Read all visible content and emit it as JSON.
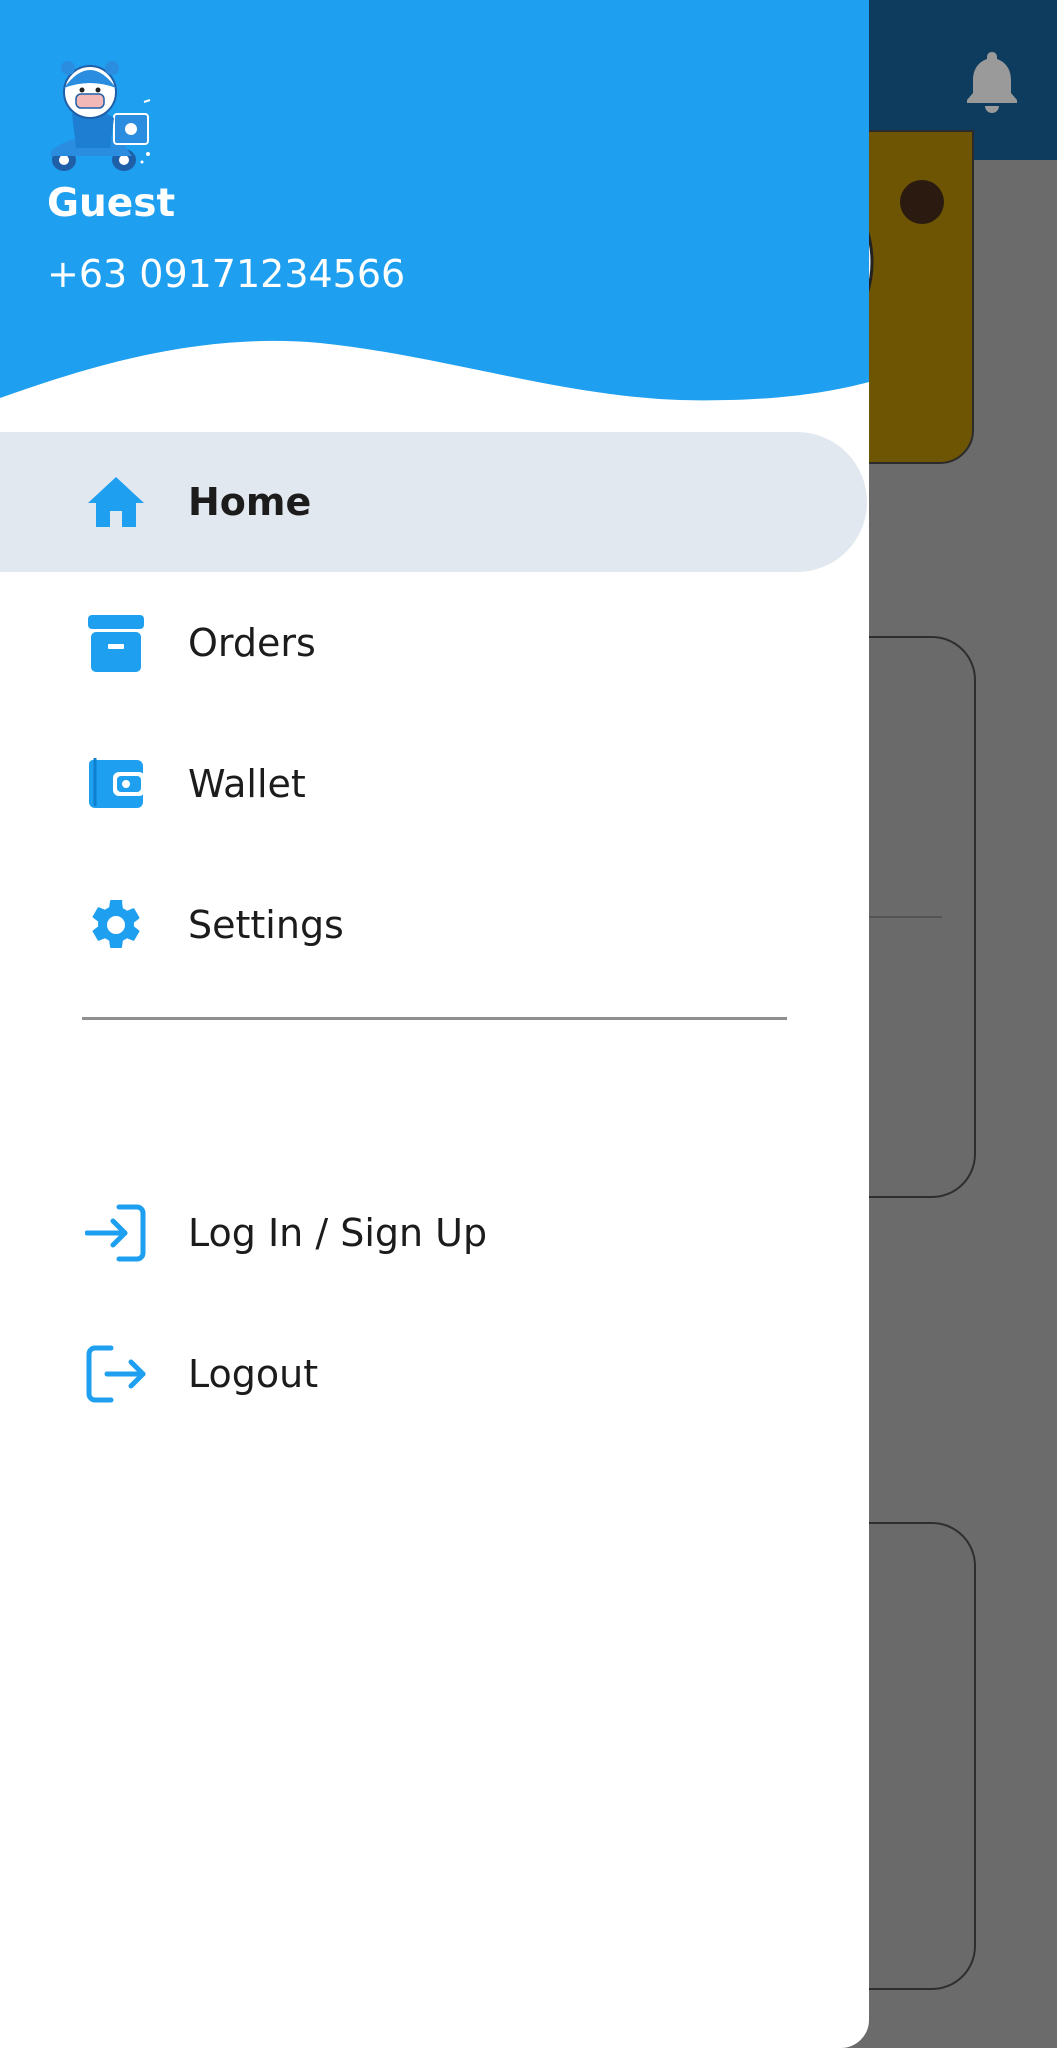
{
  "user": {
    "name": "Guest",
    "phone": "+63 09171234566"
  },
  "menu": {
    "items": [
      {
        "label": "Home",
        "icon": "home-icon",
        "active": true
      },
      {
        "label": "Orders",
        "icon": "archive-box-icon",
        "active": false
      },
      {
        "label": "Wallet",
        "icon": "wallet-icon",
        "active": false
      },
      {
        "label": "Settings",
        "icon": "gear-icon",
        "active": false
      }
    ],
    "account_items": [
      {
        "label": "Log In / Sign Up",
        "icon": "login-icon"
      },
      {
        "label": "Logout",
        "icon": "logout-icon"
      }
    ]
  },
  "background": {
    "notification_icon": "bell-icon"
  },
  "colors": {
    "primary": "#1e9ff0",
    "header_bg": "#1e9ff0",
    "active_item_bg": "#e2e8ef",
    "background_topbar": "#0d3c5e",
    "text": "#1c1c1c"
  }
}
